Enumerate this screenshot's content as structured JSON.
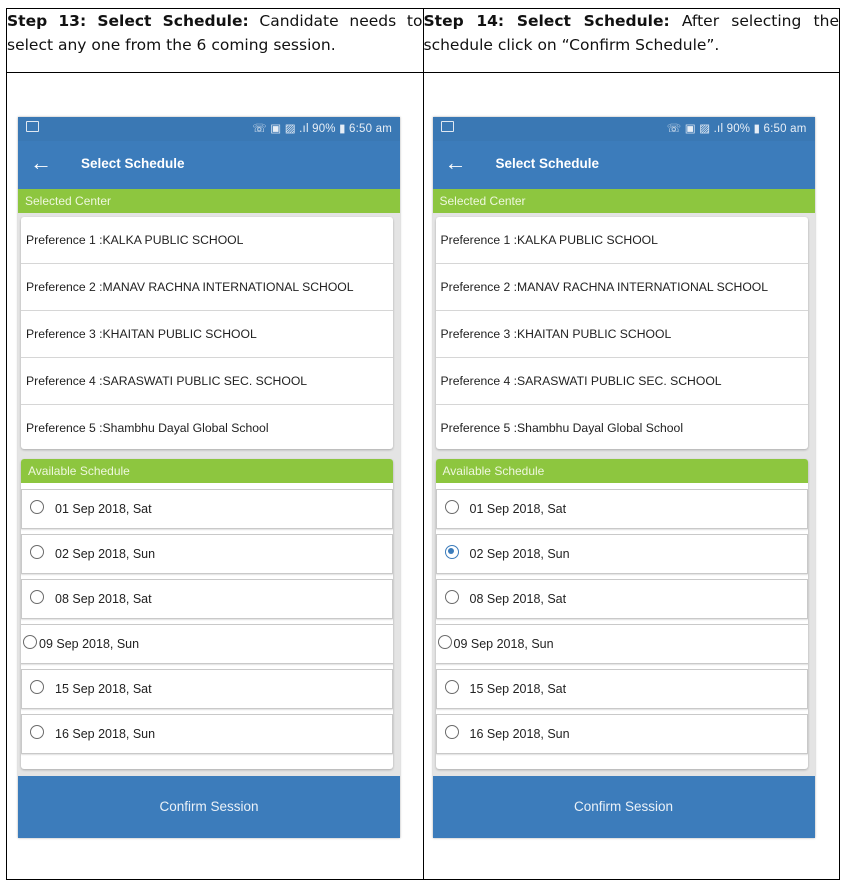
{
  "steps": [
    {
      "bold": "Step 13: Select Schedule:",
      "text": " Candidate needs to select any one from the 6 coming session.",
      "selected_index": -1
    },
    {
      "bold": "Step 14: Select Schedule:",
      "text": " After selecting the schedule click on “Confirm Schedule”.",
      "selected_index": 1
    }
  ],
  "phone": {
    "status_text": "☏ ▣ ▨ .ıl 90% ▮ 6:50 am",
    "back_icon": "←",
    "title": "Select Schedule",
    "selected_center_header": "Selected Center",
    "preferences": [
      "Preference 1 :KALKA PUBLIC SCHOOL",
      "Preference 2 :MANAV RACHNA INTERNATIONAL SCHOOL",
      "Preference 3 :KHAITAN PUBLIC SCHOOL",
      "Preference 4 :SARASWATI PUBLIC SEC. SCHOOL",
      "Preference 5 :Shambhu Dayal Global School"
    ],
    "available_header": "Available Schedule",
    "schedules": [
      "01 Sep 2018, Sat",
      "02 Sep 2018, Sun",
      "08 Sep 2018, Sat",
      "09 Sep 2018, Sun",
      "15 Sep 2018, Sat",
      "16 Sep 2018, Sun"
    ],
    "confirm_label": "Confirm Session"
  },
  "colors": {
    "primary_blue": "#3c7cbb",
    "green_header": "#8dc63f",
    "radio_selected": "#3c7cbb"
  }
}
